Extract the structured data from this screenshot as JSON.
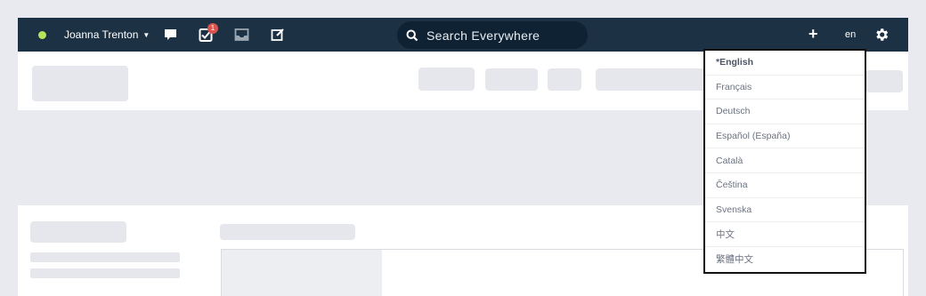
{
  "topbar": {
    "user_name": "Joanna Trenton",
    "tasks_badge": "1",
    "search_placeholder": "Search Everywhere",
    "add_label": "+",
    "language_code": "en",
    "status_color": "#b6e35a",
    "icons": [
      "status-dot",
      "chevron-down-icon",
      "chat-icon",
      "tasks-icon",
      "inbox-icon",
      "compose-icon",
      "search-icon",
      "plus-icon",
      "gear-icon"
    ]
  },
  "language_menu": {
    "items": [
      {
        "label": "*English",
        "selected": true
      },
      {
        "label": "Français",
        "selected": false
      },
      {
        "label": "Deutsch",
        "selected": false
      },
      {
        "label": "Español (España)",
        "selected": false
      },
      {
        "label": "Català",
        "selected": false
      },
      {
        "label": "Čeština",
        "selected": false
      },
      {
        "label": "Svenska",
        "selected": false
      },
      {
        "label": "中文",
        "selected": false
      },
      {
        "label": "繁體中文",
        "selected": false
      }
    ]
  },
  "colors": {
    "topbar_bg": "#1c3144",
    "search_bg": "#0f2233",
    "page_bg": "#e9eaef",
    "badge": "#d9534f"
  }
}
